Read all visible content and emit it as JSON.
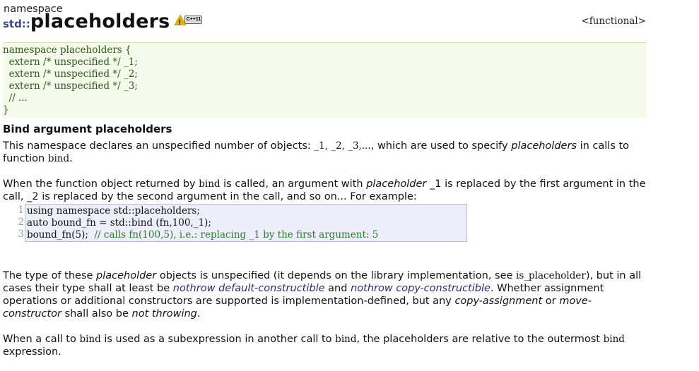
{
  "header": {
    "kind": "namespace",
    "prefix": "std::",
    "name": "placeholders",
    "badge": "C++11",
    "file": "<functional>"
  },
  "declaration": [
    "namespace placeholders {",
    "  extern /* unspecified */ _1;",
    "  extern /* unspecified */ _2;",
    "  extern /* unspecified */ _3;",
    "  // ...",
    "}"
  ],
  "section_title": "Bind argument placeholders",
  "p1": {
    "a": "This namespace declares an unspecified number of objects: ",
    "objs": "_1, _2, _3,...",
    "b": ", which are used to specify ",
    "em": "placeholders",
    "c": " in calls to function ",
    "code": "bind",
    "d": "."
  },
  "p2": {
    "a": "When the function object returned by ",
    "code": "bind",
    "b": " is called, an argument with ",
    "em": "placeholder",
    "c": " _1 is replaced by the first argument in the call, _2 is replaced by the second argument in the call, and so on... For example:"
  },
  "example": {
    "line_numbers": [
      "1",
      "2",
      "3"
    ],
    "line1": "using namespace std::placeholders;",
    "line2": "auto bound_fn = std::bind (fn,100,_1);",
    "line3_code": "bound_fn(5);  ",
    "line3_comment": "// calls fn(100,5), i.e.: replacing _1 by the first argument: 5"
  },
  "p3": {
    "a": "The type of these ",
    "em1": "placeholder",
    "b": " objects is unspecified (it depends on the library implementation, see ",
    "code": "is_placeholder",
    "c": "), but in all cases their type shall at least be ",
    "link1": "nothrow default-constructible",
    "d": " and ",
    "link2": "nothrow copy-constructible",
    "e": ". Whether assignment operations or additional constructors are supported is implementation-defined, but any ",
    "em2": "copy-assignment",
    "f": " or ",
    "em3": "move-constructor",
    "g": " shall also be ",
    "em4": "not throwing",
    "h": "."
  },
  "p4": {
    "a": "When a call to ",
    "code1": "bind",
    "b": " is used as a subexpression in another call to ",
    "code2": "bind",
    "c": ", the placeholders are relative to the outermost ",
    "code3": "bind",
    "d": " expression."
  },
  "colors": {
    "decl_bg": "#f4fbeb",
    "decl_text": "#2e5a1a",
    "example_bg": "#eeeefa",
    "link": "#2a2a78",
    "badge_warning": "#e0b000"
  }
}
